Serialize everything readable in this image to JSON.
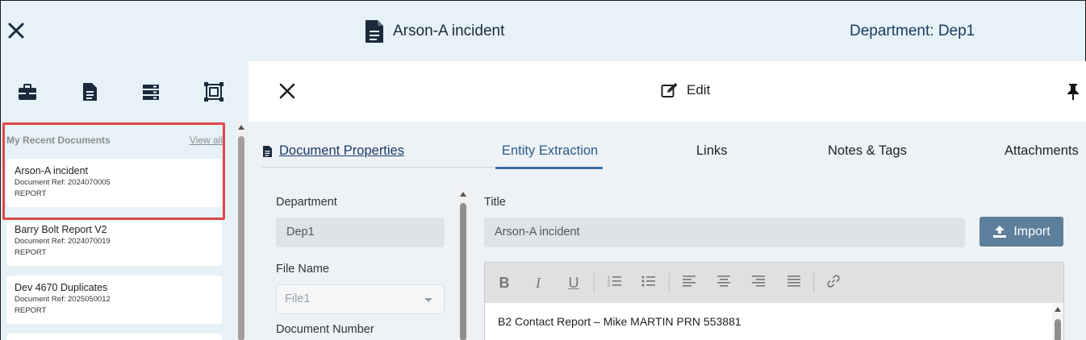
{
  "header": {
    "document_title": "Arson-A incident",
    "department": "Department: Dep1"
  },
  "sidebar": {
    "icons": [
      "briefcase-icon",
      "document-icon",
      "list-icon",
      "frame-icon"
    ],
    "recent": {
      "title": "My Recent Documents",
      "view_all": "View all",
      "items": [
        {
          "name": "Arson-A incident",
          "ref": "Document Ref: 2024070005",
          "type": "REPORT"
        },
        {
          "name": "Barry Bolt Report V2",
          "ref": "Document Ref: 2024070019",
          "type": "REPORT"
        },
        {
          "name": "Dev 4670 Duplicates",
          "ref": "Document Ref: 2025050012",
          "type": "REPORT"
        }
      ]
    }
  },
  "main": {
    "edit_label": "Edit",
    "tabs": {
      "document_properties": "Document Properties",
      "entity_extraction": "Entity Extraction",
      "links": "Links",
      "notes_tags": "Notes & Tags",
      "attachments": "Attachments"
    },
    "active_tab": "Entity Extraction",
    "form": {
      "department_label": "Department",
      "department_value": "Dep1",
      "file_name_label": "File Name",
      "file_name_value": "File1",
      "document_number_label": "Document Number",
      "title_label": "Title",
      "title_value": "Arson-A incident",
      "import_label": "Import"
    },
    "editor": {
      "toolbar": [
        "bold",
        "italic",
        "underline",
        "ordered-list",
        "bullet-list",
        "align-left",
        "align-center",
        "align-right",
        "justify",
        "link"
      ],
      "content": "B2 Contact Report – Mike MARTIN PRN 553881"
    }
  },
  "colors": {
    "header_bg": "#e6f1f8",
    "highlight": "#e04848",
    "active_tab": "#3a6ea5",
    "import_button": "#5d7f9b"
  }
}
